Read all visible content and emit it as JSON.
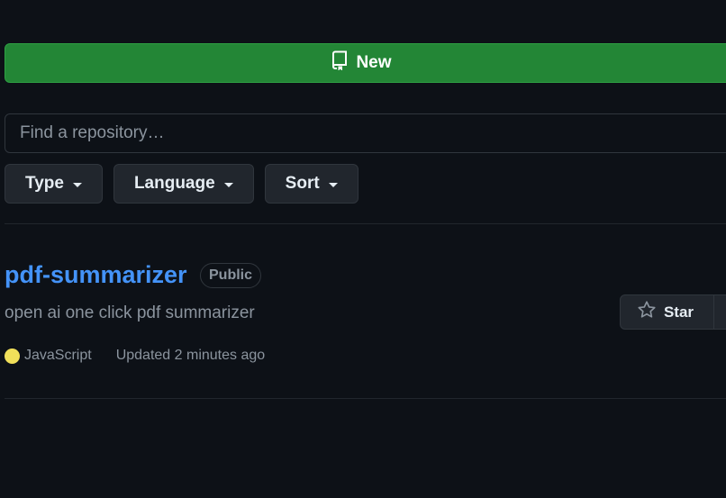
{
  "toolbar": {
    "new_label": "New",
    "search_placeholder": "Find a repository…"
  },
  "filters": [
    {
      "label": "Type"
    },
    {
      "label": "Language"
    },
    {
      "label": "Sort"
    }
  ],
  "repo": {
    "name": "pdf-summarizer",
    "visibility": "Public",
    "description": "open ai one click pdf summarizer",
    "language": "JavaScript",
    "language_color": "#f1e05a",
    "updated": "Updated 2 minutes ago",
    "star_label": "Star"
  },
  "colors": {
    "background": "#0d1117",
    "primary_button": "#238636",
    "link": "#4493f8"
  }
}
